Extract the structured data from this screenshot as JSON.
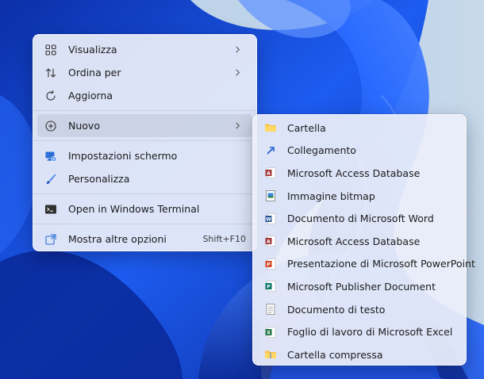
{
  "main_menu": {
    "items": [
      {
        "label": "Visualizza"
      },
      {
        "label": "Ordina per"
      },
      {
        "label": "Aggiorna"
      },
      {
        "label": "Nuovo"
      },
      {
        "label": "Impostazioni schermo"
      },
      {
        "label": "Personalizza"
      },
      {
        "label": "Open in Windows Terminal"
      },
      {
        "label": "Mostra altre opzioni",
        "shortcut": "Shift+F10"
      }
    ]
  },
  "new_submenu": {
    "items": [
      {
        "label": "Cartella",
        "icon": "folder-icon"
      },
      {
        "label": "Collegamento",
        "icon": "shortcut-icon"
      },
      {
        "label": "Microsoft Access Database",
        "icon": "access-icon"
      },
      {
        "label": "Immagine bitmap",
        "icon": "bitmap-icon"
      },
      {
        "label": "Documento di Microsoft Word",
        "icon": "word-icon"
      },
      {
        "label": "Microsoft Access Database",
        "icon": "access-icon"
      },
      {
        "label": "Presentazione di Microsoft PowerPoint",
        "icon": "powerpoint-icon"
      },
      {
        "label": "Microsoft Publisher Document",
        "icon": "publisher-icon"
      },
      {
        "label": "Documento di testo",
        "icon": "text-document-icon"
      },
      {
        "label": "Foglio di lavoro di Microsoft Excel",
        "icon": "excel-icon"
      },
      {
        "label": "Cartella compressa",
        "icon": "zip-folder-icon"
      }
    ]
  },
  "colors": {
    "wallpaper_blue": "#1a4fd8",
    "word": "#2b579a",
    "excel": "#217346",
    "powerpoint": "#d24726",
    "access": "#a4373a",
    "publisher": "#077568",
    "folder": "#f6c243"
  }
}
